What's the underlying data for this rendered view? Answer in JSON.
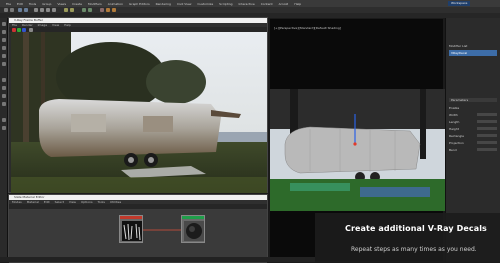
{
  "app": {
    "menu_items": [
      "File",
      "Edit",
      "Tools",
      "Group",
      "Views",
      "Create",
      "Modifiers",
      "Animation",
      "Graph Editors",
      "Rendering",
      "Civil View",
      "Customize",
      "Scripting",
      "Interactive",
      "Content",
      "Arnold",
      "Help"
    ],
    "workspace_label": "Workspace",
    "accent_color": "#1f3e6a"
  },
  "vfb": {
    "title": "V-Ray Frame Buffer",
    "menu": [
      "File",
      "Render",
      "Image",
      "View",
      "Help"
    ]
  },
  "viewport": {
    "label": "[+][Perspective][Standard][Default Shading]"
  },
  "command_panel": {
    "rollouts": [
      {
        "label": "Modifier List",
        "type": "dropdown"
      },
      {
        "label": "VRayDecal",
        "type": "selected"
      },
      {
        "label": "Parameters",
        "type": "header"
      },
      {
        "label": "Enable",
        "type": "check"
      },
      {
        "label": "Width",
        "type": "field"
      },
      {
        "label": "Length",
        "type": "field"
      },
      {
        "label": "Height",
        "type": "field"
      },
      {
        "label": "Rectangle",
        "type": "field"
      },
      {
        "label": "Projection",
        "type": "field"
      },
      {
        "label": "Bend",
        "type": "field"
      }
    ]
  },
  "slate": {
    "title": "Slate Material Editor",
    "menu": [
      "Modes",
      "Material",
      "Edit",
      "Select",
      "View",
      "Options",
      "Tools",
      "Utilities"
    ],
    "nodes": [
      {
        "name": "bitmap-node",
        "head_color": "#c0392b"
      },
      {
        "name": "material-node",
        "head_color": "#1f9e4a"
      }
    ]
  },
  "promo": {
    "title": "Create additional V-Ray Decals",
    "subtitle": "Repeat steps as many times as you need."
  }
}
